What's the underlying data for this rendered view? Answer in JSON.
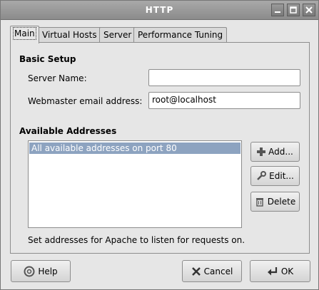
{
  "window": {
    "title": "HTTP"
  },
  "titlebar_icons": [
    "minimize-icon",
    "maximize-icon",
    "close-icon"
  ],
  "tabs": [
    {
      "label": "Main",
      "active": true
    },
    {
      "label": "Virtual Hosts",
      "active": false
    },
    {
      "label": "Server",
      "active": false
    },
    {
      "label": "Performance Tuning",
      "active": false
    }
  ],
  "basic_setup": {
    "title": "Basic Setup",
    "server_name_label": "Server Name:",
    "server_name_value": "",
    "webmaster_label": "Webmaster email address:",
    "webmaster_value": "root@localhost"
  },
  "addresses": {
    "title": "Available Addresses",
    "items": [
      "All available addresses on port 80"
    ],
    "add_label": "Add...",
    "edit_label": "Edit...",
    "delete_label": "Delete",
    "note": "Set addresses for Apache to listen for requests on."
  },
  "footer": {
    "help_label": "Help",
    "cancel_label": "Cancel",
    "ok_label": "OK"
  },
  "colors": {
    "selection": "#8da3c0",
    "titlebar": "#8b8b8b"
  }
}
